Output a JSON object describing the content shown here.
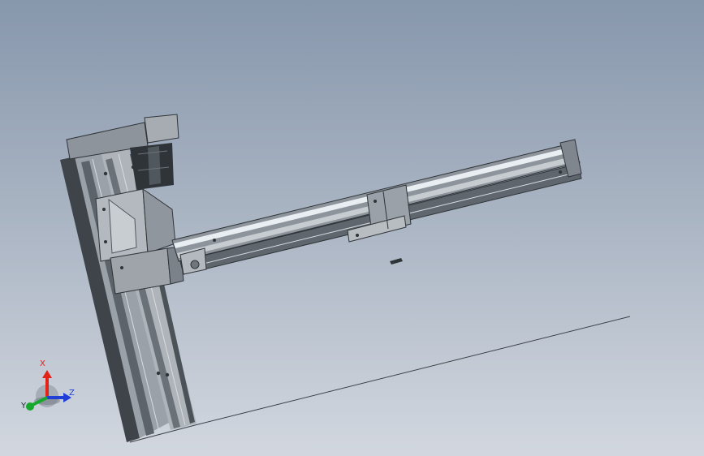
{
  "viewport": {
    "background_top": "#8797ac",
    "background_bottom": "#d2d7df"
  },
  "model": {
    "description_icon": "linear-actuator-assembly-icon",
    "part_colors": {
      "rail_body": "#9aa1a8",
      "rail_dark": "#3e444a",
      "carriage": "#b4b9bf",
      "motor": "#2f3438",
      "arm_highlight": "#e9eef2"
    }
  },
  "triad": {
    "x_label": "X",
    "y_label": "Y",
    "z_label": "Z",
    "x_color": "#e2231a",
    "y_color": "#17a82e",
    "z_color": "#1f3fd6"
  }
}
